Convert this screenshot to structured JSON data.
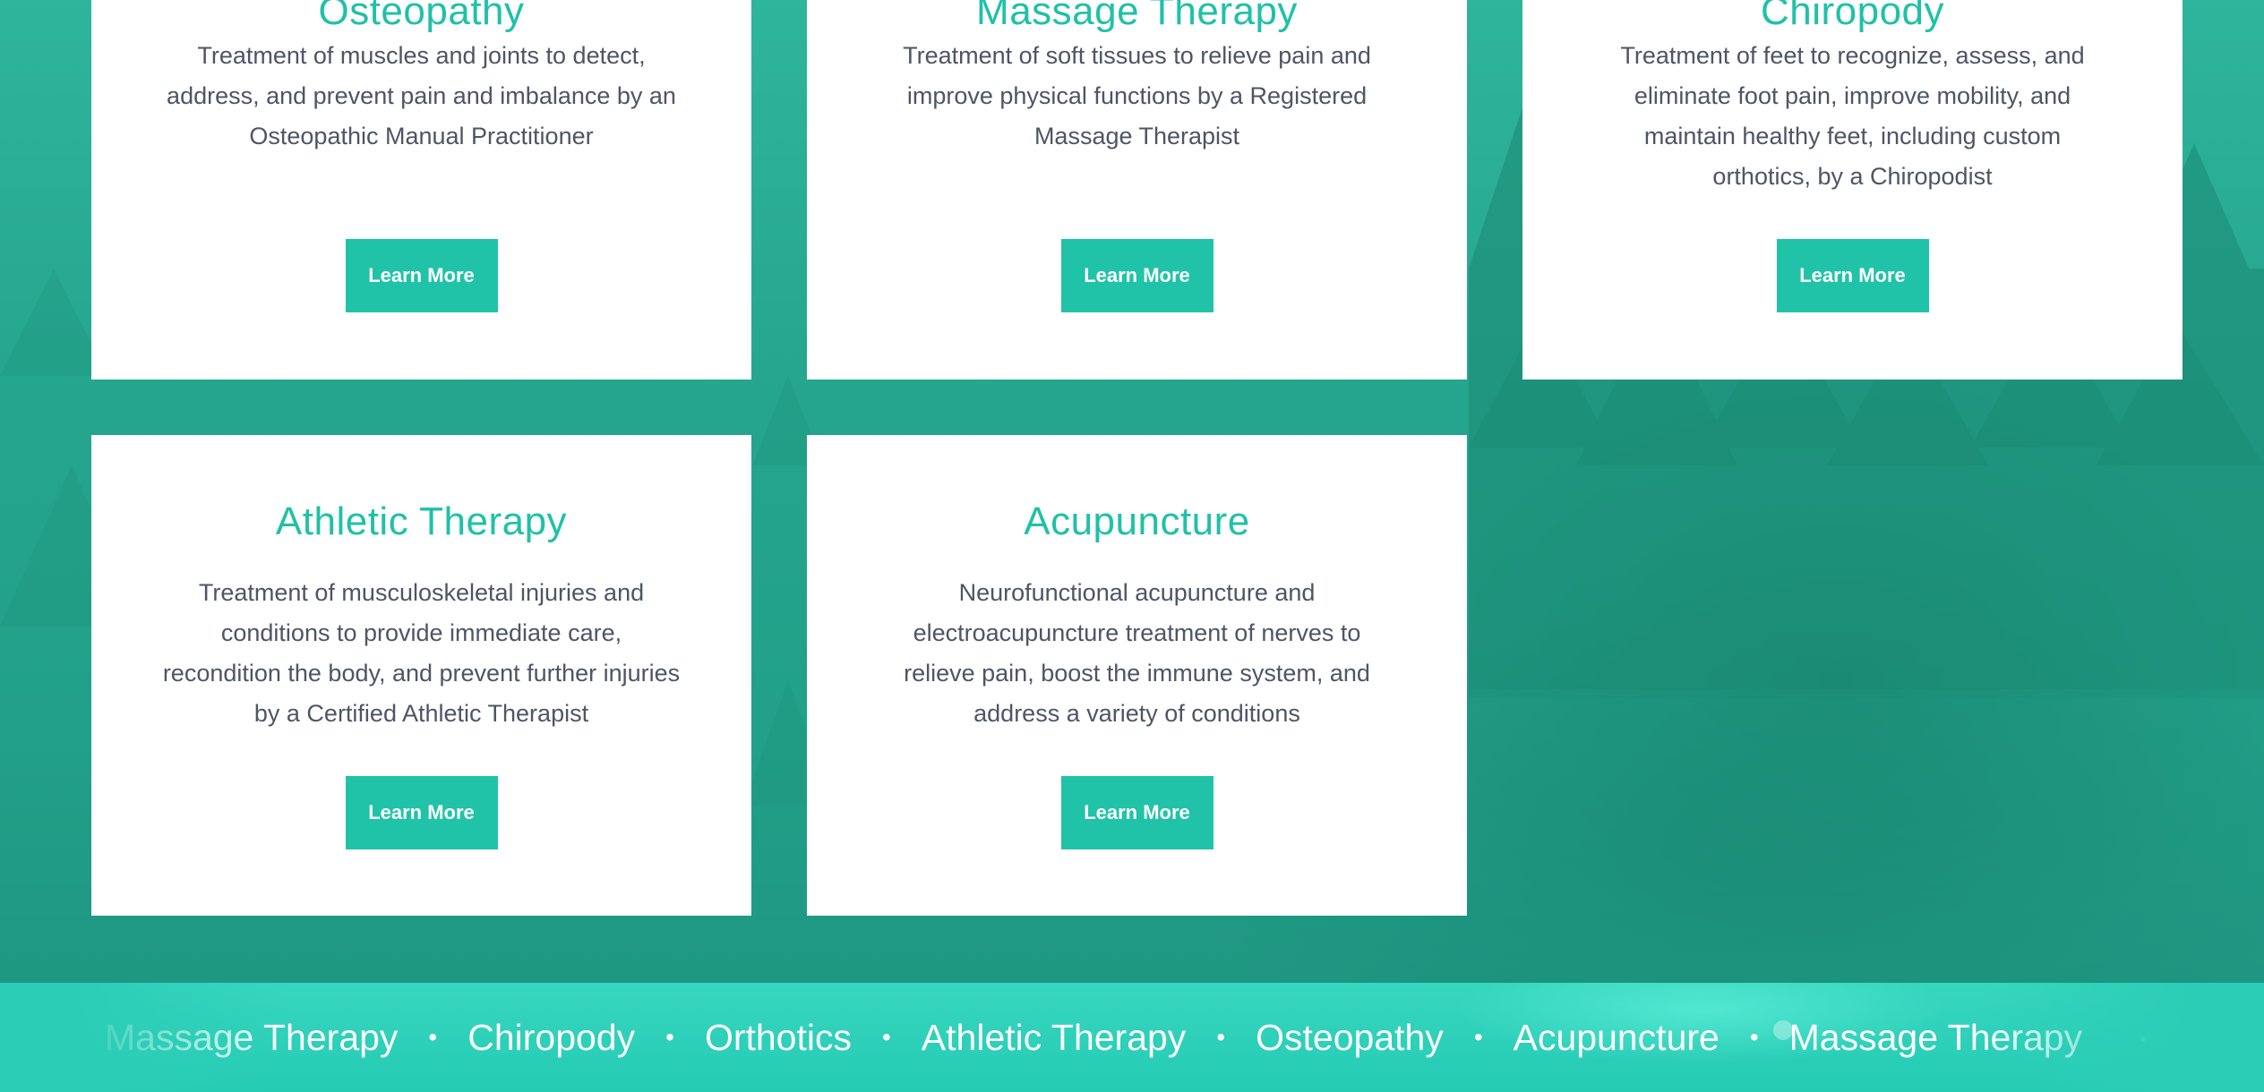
{
  "cards": [
    {
      "title": "Osteopathy",
      "description": "Treatment of muscles and joints to detect, address, and prevent pain and imbalance by an Osteopathic Manual Practitioner",
      "button": "Learn More"
    },
    {
      "title": "Massage Therapy",
      "description": "Treatment of soft tissues to relieve pain and improve physical functions by a Registered Massage Therapist",
      "button": "Learn More"
    },
    {
      "title": "Chiropody",
      "description": "Treatment of feet to recognize, assess, and eliminate foot pain, improve mobility, and maintain healthy feet, including custom orthotics, by a Chiropodist",
      "button": "Learn More"
    },
    {
      "title": "Athletic Therapy",
      "description": "Treatment of musculoskeletal injuries and conditions to provide immediate care, recondition the body, and prevent further injuries by a Certified Athletic Therapist",
      "button": "Learn More"
    },
    {
      "title": "Acupuncture",
      "description": "Neurofunctional acupuncture and electroacupuncture treatment of nerves to relieve pain, boost the immune system, and address a variety of conditions",
      "button": "Learn More"
    }
  ],
  "marquee": {
    "items": [
      "Massage Therapy",
      "Chiropody",
      "Orthotics",
      "Athletic Therapy",
      "Osteopathy",
      "Acupuncture",
      "Massage Therapy"
    ],
    "separator": "•"
  },
  "colors": {
    "accent": "#21c3a8",
    "title": "#1fc1a7",
    "body_text": "#4d5566",
    "background": "#25a58e"
  }
}
